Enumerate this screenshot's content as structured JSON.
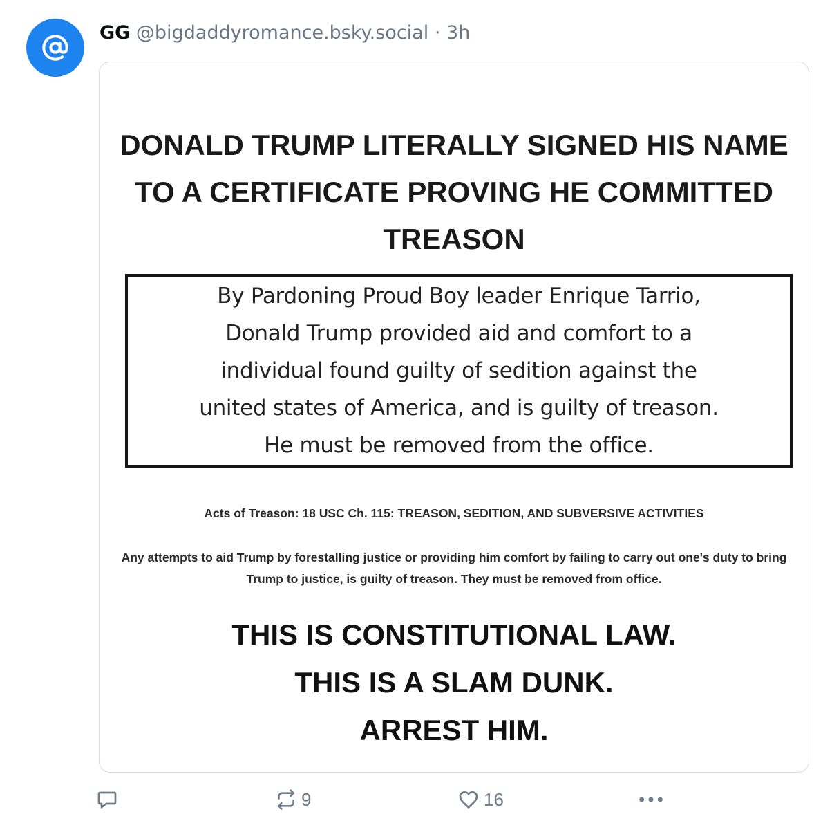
{
  "post": {
    "avatar_icon": "at-sign-icon",
    "display_name": "GG",
    "handle": "@bigdaddyromance.bsky.social",
    "separator": "·",
    "time": "3h",
    "image": {
      "headline": "DONALD TRUMP LITERALLY SIGNED HIS NAME TO A CERTIFICATE PROVING HE COMMITTED TREASON",
      "boxed_lines": [
        "By Pardoning Proud Boy leader Enrique Tarrio,",
        "Donald Trump provided aid and comfort to a",
        "individual found guilty of sedition against the",
        "united states of America, and is guilty of treason.",
        "He must be removed from the office."
      ],
      "acts": "Acts of Treason: 18 USC Ch. 115: TREASON, SEDITION, AND SUBVERSIVE ACTIVITIES",
      "attempts": "Any attempts to aid Trump by forestalling justice or providing him comfort by failing to carry out one's duty to bring Trump to justice, is guilty of treason. They must be removed from office.",
      "closing_lines": [
        "THIS IS CONSTITUTIONAL LAW.",
        "THIS IS A SLAM DUNK.",
        "ARREST HIM."
      ]
    },
    "actions": {
      "reply_icon": "comment-icon",
      "repost_icon": "repost-icon",
      "repost_count": "9",
      "like_icon": "heart-icon",
      "like_count": "16",
      "more_icon": "more-icon"
    }
  },
  "colors": {
    "avatar_bg": "#1d83ef",
    "muted_text": "#687684",
    "card_border": "#d7dde3"
  }
}
